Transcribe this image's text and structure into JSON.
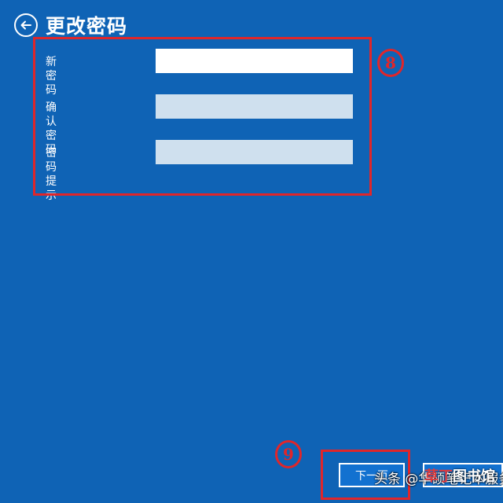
{
  "header": {
    "back_icon": "arrow-left-circle-icon",
    "title": "更改密码"
  },
  "form": {
    "fields": [
      {
        "label": "新密码",
        "state": "active"
      },
      {
        "label": "确认密码",
        "state": "inactive"
      },
      {
        "label": "密码提示",
        "state": "inactive"
      }
    ]
  },
  "annotations": {
    "step_a": "8",
    "step_b": "9",
    "color": "#e0262a"
  },
  "footer": {
    "next_label": "下一页"
  },
  "watermark": {
    "text": "头条 @华硕笔记本服务",
    "tag_a": "草丁",
    "tag_b": "图书馆"
  },
  "colors": {
    "background": "#0f63b5",
    "input_active": "#ffffff",
    "input_inactive": "#cfe0ee"
  }
}
